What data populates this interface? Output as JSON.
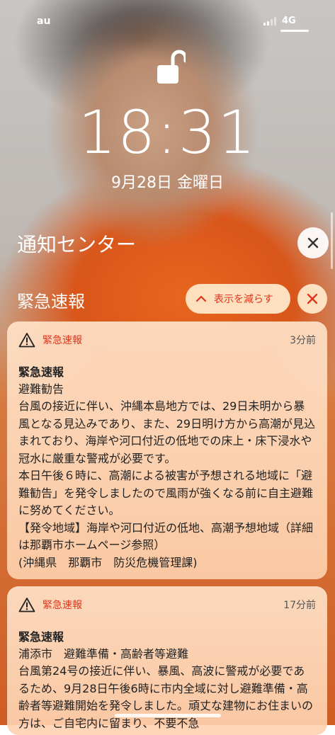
{
  "status": {
    "carrier": "au",
    "network": "4G"
  },
  "lock": {
    "time": "18:31",
    "date": "9月28日 金曜日"
  },
  "notification_center": {
    "title": "通知センター"
  },
  "group": {
    "title": "緊急速報",
    "show_less_label": "表示を減らす"
  },
  "notifications": [
    {
      "app": "緊急速報",
      "ago": "3分前",
      "title": "緊急速報",
      "subtitle": "避難勧告",
      "body": "台風の接近に伴い、沖縄本島地方では、29日未明から暴風となる見込みであり、また、29日明け方から高潮が見込まれており、海岸や河口付近の低地での床上・床下浸水や冠水に厳重な警戒が必要です。\n本日午後６時に、高潮による被害が予想される地域に「避難勧告」を発令しましたので風雨が強くなる前に自主避難に努めてください。\n【発令地域】海岸や河口付近の低地、高潮予想地域（詳細は那覇市ホームページ参照）\n(沖縄県　那覇市　防災危機管理課)"
    },
    {
      "app": "緊急速報",
      "ago": "17分前",
      "title": "緊急速報",
      "subtitle": "浦添市　避難準備・高齢者等避難",
      "body": "台風第24号の接近に伴い、暴風、高波に警戒が必要であるため、9月28日午後6時に市内全域に対し避難準備・高齢者等避難開始を発令しました。頑丈な建物にお住まいの方は、ご自宅内に留まり、不要不急"
    }
  ],
  "colors": {
    "accent": "#e0351c"
  },
  "icons": [
    "unlock-icon",
    "close-icon",
    "chevron-up-icon",
    "warning-icon"
  ]
}
